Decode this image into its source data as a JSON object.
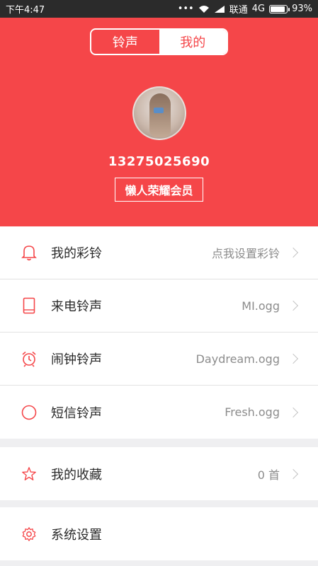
{
  "status": {
    "time": "下午4:47",
    "carrier": "联通",
    "network": "4G",
    "battery": "93%",
    "battery_level": 0.93
  },
  "header": {
    "tabs": [
      {
        "label": "铃声",
        "active": false
      },
      {
        "label": "我的",
        "active": true
      }
    ],
    "phone": "13275025690",
    "member_label": "懒人荣耀会员",
    "accent_color": "#f54649"
  },
  "ringtones": [
    {
      "label": "我的彩铃",
      "value": "点我设置彩铃",
      "icon": "bell-icon"
    },
    {
      "label": "来电铃声",
      "value": "MI.ogg",
      "icon": "phone-icon"
    },
    {
      "label": "闹钟铃声",
      "value": "Daydream.ogg",
      "icon": "alarm-clock-icon"
    },
    {
      "label": "短信铃声",
      "value": "Fresh.ogg",
      "icon": "circle-icon"
    }
  ],
  "favorites": {
    "label": "我的收藏",
    "value": "0 首",
    "icon": "star-icon"
  },
  "settings": {
    "label": "系统设置",
    "icon": "gear-icon"
  }
}
